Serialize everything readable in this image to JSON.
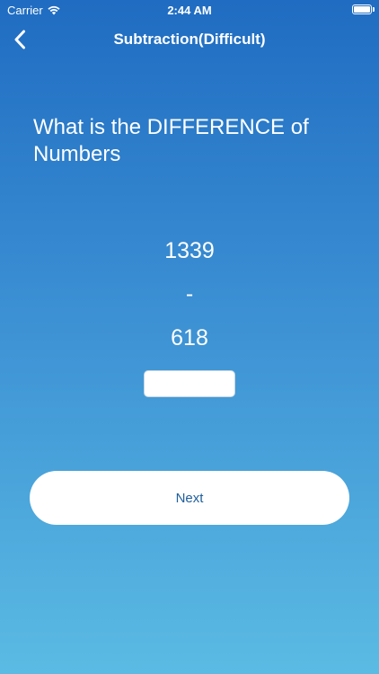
{
  "status_bar": {
    "carrier": "Carrier",
    "time": "2:44 AM",
    "wifi_icon": "wifi-icon",
    "battery_icon": "battery-icon"
  },
  "nav": {
    "back_icon": "chevron-left-icon",
    "title": "Subtraction(Difficult)"
  },
  "question": {
    "text": "What is the DIFFERENCE of Numbers"
  },
  "problem": {
    "first_number": "1339",
    "operator": "-",
    "second_number": "618"
  },
  "answer": {
    "value": ""
  },
  "actions": {
    "next_label": "Next"
  },
  "colors": {
    "gradient_top": "#1f6cc2",
    "gradient_bottom": "#5bbbe3",
    "button_text": "#1f5f9c"
  }
}
